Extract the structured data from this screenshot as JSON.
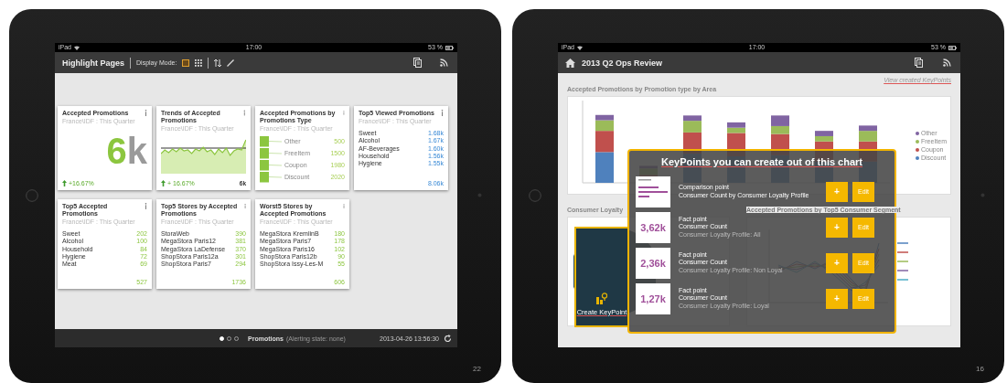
{
  "left_tablet": {
    "page_number": "22",
    "screen": {
      "status_bar": {
        "device": "iPad",
        "time": "17:00",
        "battery": "53 %"
      },
      "toolbar": {
        "title": "Highlight Pages",
        "display_mode_label": "Display Mode:",
        "display_modes": [
          {
            "kind": "single",
            "selected": true
          },
          {
            "kind": "grid",
            "selected": false
          }
        ]
      },
      "cards": [
        {
          "kind": "kpi",
          "title": "Accepted Promotions",
          "subtitle": "France\\IDF : This Quarter",
          "value": "6k",
          "change": "+16.67%"
        },
        {
          "kind": "trend",
          "title": "Trends of Accepted Promotions",
          "subtitle": "France\\IDF : This Quarter",
          "change": "+ 16.67%",
          "total": "6k"
        },
        {
          "kind": "breakdown",
          "title": "Accepted Promotions by Promotions Type",
          "subtitle": "France\\IDF : This Quarter",
          "items": [
            {
              "label": "Other",
              "value": "500"
            },
            {
              "label": "FreeItem",
              "value": "1500"
            },
            {
              "label": "Coupon",
              "value": "1980"
            },
            {
              "label": "Discount",
              "value": "2020"
            }
          ]
        },
        {
          "kind": "views",
          "title": "Top5 Viewed Promotions",
          "subtitle": "France\\IDF : This Quarter",
          "items": [
            {
              "label": "Sweet",
              "value": "1.68k"
            },
            {
              "label": "Alcohol",
              "value": "1.67k"
            },
            {
              "label": "AF-Beverages",
              "value": "1.60k"
            },
            {
              "label": "Household",
              "value": "1.56k"
            },
            {
              "label": "Hygiene",
              "value": "1.55k"
            }
          ],
          "total": "8.06k"
        },
        {
          "kind": "list",
          "title": "Top5 Accepted Promotions",
          "subtitle": "France\\IDF : This Quarter",
          "items": [
            {
              "label": "Sweet",
              "value": "202"
            },
            {
              "label": "Alcohol",
              "value": "100"
            },
            {
              "label": "Household",
              "value": "84"
            },
            {
              "label": "Hygiene",
              "value": "72"
            },
            {
              "label": "Meat",
              "value": "69"
            }
          ],
          "total": "527"
        },
        {
          "kind": "list",
          "title": "Top5 Stores by Accepted Promotions",
          "subtitle": "France\\IDF : This Quarter",
          "items": [
            {
              "label": "StoraWeb",
              "value": "390"
            },
            {
              "label": "MegaStora Paris12",
              "value": "381"
            },
            {
              "label": "MegaStora LaDefense",
              "value": "370"
            },
            {
              "label": "ShopStora Paris12a",
              "value": "301"
            },
            {
              "label": "ShopStora Paris7",
              "value": "294"
            }
          ],
          "total": "1736"
        },
        {
          "kind": "list",
          "title": "Worst5 Stores by Accepted Promotions",
          "subtitle": "France\\IDF : This Quarter",
          "items": [
            {
              "label": "MegaStora KremlinB",
              "value": "180"
            },
            {
              "label": "MegaStora Paris7",
              "value": "178"
            },
            {
              "label": "MegaStora Paris16",
              "value": "102"
            },
            {
              "label": "ShopStora Paris12b",
              "value": "90"
            },
            {
              "label": "ShopStora Issy-Les-M",
              "value": "55"
            }
          ],
          "total": "606"
        }
      ],
      "footer": {
        "pages": [
          {
            "selected": true
          },
          {
            "selected": false
          },
          {
            "selected": false
          }
        ],
        "title": "Promotions",
        "state": "(Alerting state: none)",
        "timestamp": "2013-04-26 13:56:30"
      }
    }
  },
  "right_tablet": {
    "page_number": "16",
    "screen": {
      "status_bar": {
        "device": "iPad",
        "time": "17:00",
        "battery": "53 %"
      },
      "toolbar": {
        "title": "2013 Q2 Ops Review"
      },
      "link": "View created KeyPoints",
      "bar_chart": {
        "title": "Accepted Promotions by Promotion type by Area",
        "legend": [
          {
            "label": "Other",
            "color": "#8064a2"
          },
          {
            "label": "FreeItem",
            "color": "#9bbb59"
          },
          {
            "label": "Coupon",
            "color": "#c0504d"
          },
          {
            "label": "Discount",
            "color": "#4f81bd"
          }
        ]
      },
      "loyalty_panel": {
        "title": "Consumer Loyalty"
      },
      "line_chart": {
        "title": "Accepted Promotions by Top5 Consumer Segment"
      },
      "create_button": {
        "label": "Create KeyPoint"
      },
      "keypoints_popup": {
        "title": "KeyPoints you can create out of this chart",
        "items": [
          {
            "kind": "comparison",
            "type": "Comparison point",
            "measure": "Consumer Count by Consumer Loyalty Profile",
            "add_label": "+",
            "edit_label": "Edit"
          },
          {
            "kind": "fact",
            "value": "3,62k",
            "type": "Fact point",
            "measure": "Consumer Count",
            "filter": "Consumer Loyalty Profile: All",
            "add_label": "+",
            "edit_label": "Edit"
          },
          {
            "kind": "fact",
            "value": "2,36k",
            "type": "Fact point",
            "measure": "Consumer Count",
            "filter": "Consumer Loyalty Profile: Non Loyal",
            "add_label": "+",
            "edit_label": "Edit"
          },
          {
            "kind": "fact",
            "value": "1,27k",
            "type": "Fact point",
            "measure": "Consumer Count",
            "filter": "Consumer Loyalty Profile: Loyal",
            "add_label": "+",
            "edit_label": "Edit"
          }
        ]
      }
    }
  }
}
